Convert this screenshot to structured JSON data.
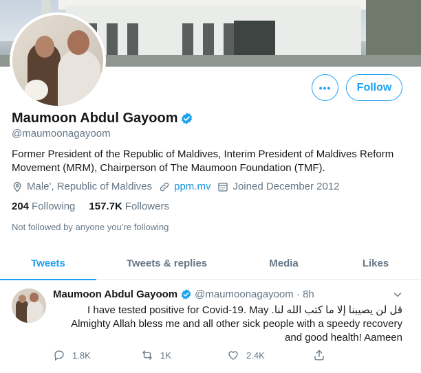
{
  "profile": {
    "name": "Maumoon Abdul Gayoom",
    "handle": "@maumoonagayoom",
    "bio": "Former President of the Republic of Maldives, Interim President of Maldives Reform Movement (MRM), Chairperson of The Maumoon Foundation (TMF).",
    "location": "Male', Republic of Maldives",
    "website": "ppm.mv",
    "joined": "Joined December 2012",
    "following_count": "204",
    "following_label": "Following",
    "followers_count": "157.7K",
    "followers_label": "Followers",
    "not_followed": "Not followed by anyone you’re following"
  },
  "actions": {
    "more_label": "•••",
    "follow_label": "Follow"
  },
  "tabs": [
    {
      "label": "Tweets",
      "active": true
    },
    {
      "label": "Tweets & replies",
      "active": false
    },
    {
      "label": "Media",
      "active": false
    },
    {
      "label": "Likes",
      "active": false
    }
  ],
  "tweet": {
    "name": "Maumoon Abdul Gayoom",
    "handle_time": "@maumoonagayoom · 8h",
    "text": "قل لن يصيبنا إلا ما كتب الله لنا. I have tested positive for Covid-19. May Almighty Allah bless me and all other sick people with a speedy recovery and good health! Aameen",
    "replies": "1.8K",
    "retweets": "1K",
    "likes": "2.4K"
  },
  "icons": {
    "location": "location-icon",
    "link": "link-icon",
    "calendar": "calendar-icon",
    "verified": "verified-badge-icon",
    "reply": "reply-icon",
    "retweet": "retweet-icon",
    "like": "heart-icon",
    "share": "share-icon",
    "chevron": "chevron-down-icon"
  },
  "colors": {
    "accent": "#1da1f2",
    "text": "#14171a",
    "muted": "#657786"
  }
}
